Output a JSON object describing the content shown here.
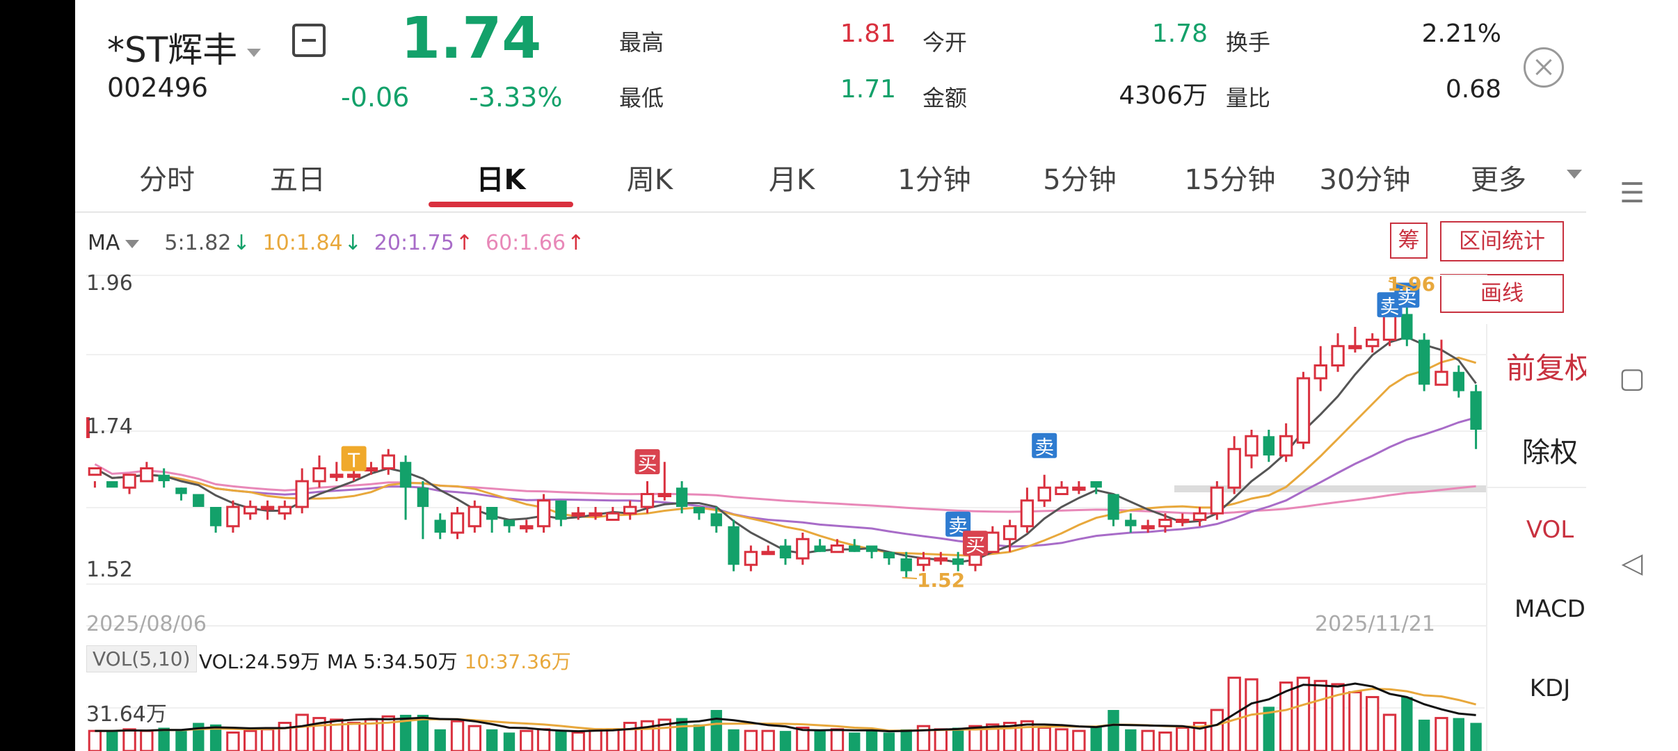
{
  "stock": {
    "name": "*ST辉丰",
    "code": "002496",
    "price": "1.74",
    "change": "-0.06",
    "change_pct": "-3.33%"
  },
  "quote": {
    "high_label": "最高",
    "high": "1.81",
    "open_label": "今开",
    "open": "1.78",
    "turnover_label": "换手",
    "turnover": "2.21%",
    "low_label": "最低",
    "low": "1.71",
    "amount_label": "金额",
    "amount": "4306万",
    "volratio_label": "量比",
    "volratio": "0.68"
  },
  "tabs": [
    "分时",
    "五日",
    "日K",
    "周K",
    "月K",
    "1分钟",
    "5分钟",
    "15分钟",
    "30分钟",
    "更多"
  ],
  "active_tab": "日K",
  "ma": {
    "label": "MA",
    "ma5": "5:1.82",
    "ma10": "10:1.84",
    "ma20": "20:1.75",
    "ma60": "60:1.66",
    "arrow_down": "↓",
    "arrow_up": "↑"
  },
  "side_buttons": {
    "chip": "筹",
    "interval_stats": "区间统计",
    "draw_line": "画线"
  },
  "adjust": {
    "forward": "前复权",
    "ex_right": "除权"
  },
  "indicators": [
    "VOL",
    "MACD",
    "KDJ"
  ],
  "axis": {
    "high": "1.96",
    "mid": "1.74",
    "low": "1.52",
    "start_date": "2025/08/06",
    "end_date": "2025/11/21",
    "vol_max": "31.64万"
  },
  "markers": {
    "max_label": "1.96",
    "min_label": "1.52",
    "buy": "买",
    "sell": "卖",
    "t": "T"
  },
  "volume": {
    "box": "VOL(5,10)",
    "vol": "VOL:24.59万",
    "ma5": "MA 5:34.50万",
    "ma10": "10:37.36万"
  },
  "colors": {
    "up": "#d9303e",
    "down": "#13a16a",
    "ma5": "#555555",
    "ma10": "#e8a83c",
    "ma20": "#a86cc8",
    "ma60": "#e888b8",
    "buy_marker": "#d9434f",
    "sell_marker": "#2e7bd0",
    "t_marker": "#f0a92b"
  },
  "chart_data": {
    "type": "candlestick",
    "candles": [
      [
        1.67,
        1.68,
        1.66,
        1.65
      ],
      [
        1.66,
        1.65,
        1.64,
        1.64
      ],
      [
        1.65,
        1.67,
        1.67,
        1.64
      ],
      [
        1.66,
        1.68,
        1.69,
        1.66
      ],
      [
        1.67,
        1.66,
        1.68,
        1.65
      ],
      [
        1.65,
        1.64,
        1.65,
        1.63
      ],
      [
        1.64,
        1.62,
        1.64,
        1.62
      ],
      [
        1.62,
        1.59,
        1.62,
        1.58
      ],
      [
        1.59,
        1.62,
        1.63,
        1.58
      ],
      [
        1.61,
        1.62,
        1.63,
        1.6
      ],
      [
        1.62,
        1.62,
        1.63,
        1.6
      ],
      [
        1.61,
        1.62,
        1.63,
        1.6
      ],
      [
        1.62,
        1.66,
        1.68,
        1.61
      ],
      [
        1.66,
        1.68,
        1.7,
        1.65
      ],
      [
        1.67,
        1.67,
        1.69,
        1.66
      ],
      [
        1.67,
        1.67,
        1.68,
        1.66
      ],
      [
        1.68,
        1.68,
        1.69,
        1.67
      ],
      [
        1.68,
        1.7,
        1.71,
        1.67
      ],
      [
        1.69,
        1.65,
        1.7,
        1.6
      ],
      [
        1.65,
        1.62,
        1.66,
        1.57
      ],
      [
        1.6,
        1.58,
        1.61,
        1.57
      ],
      [
        1.58,
        1.61,
        1.62,
        1.57
      ],
      [
        1.59,
        1.62,
        1.63,
        1.58
      ],
      [
        1.62,
        1.6,
        1.62,
        1.58
      ],
      [
        1.6,
        1.59,
        1.6,
        1.58
      ],
      [
        1.59,
        1.59,
        1.6,
        1.58
      ],
      [
        1.59,
        1.63,
        1.64,
        1.58
      ],
      [
        1.63,
        1.6,
        1.63,
        1.59
      ],
      [
        1.61,
        1.61,
        1.62,
        1.6
      ],
      [
        1.61,
        1.61,
        1.62,
        1.6
      ],
      [
        1.6,
        1.61,
        1.62,
        1.6
      ],
      [
        1.61,
        1.62,
        1.63,
        1.6
      ],
      [
        1.62,
        1.64,
        1.66,
        1.61
      ],
      [
        1.64,
        1.64,
        1.69,
        1.63
      ],
      [
        1.65,
        1.62,
        1.66,
        1.61
      ],
      [
        1.62,
        1.61,
        1.62,
        1.6
      ],
      [
        1.61,
        1.59,
        1.62,
        1.58
      ],
      [
        1.59,
        1.53,
        1.6,
        1.52
      ],
      [
        1.53,
        1.55,
        1.56,
        1.52
      ],
      [
        1.55,
        1.55,
        1.56,
        1.55
      ],
      [
        1.56,
        1.54,
        1.57,
        1.53
      ],
      [
        1.54,
        1.57,
        1.58,
        1.53
      ],
      [
        1.56,
        1.55,
        1.57,
        1.55
      ],
      [
        1.55,
        1.56,
        1.57,
        1.55
      ],
      [
        1.56,
        1.55,
        1.57,
        1.55
      ],
      [
        1.56,
        1.55,
        1.56,
        1.54
      ],
      [
        1.55,
        1.54,
        1.55,
        1.53
      ],
      [
        1.54,
        1.52,
        1.55,
        1.51
      ],
      [
        1.53,
        1.54,
        1.55,
        1.52
      ],
      [
        1.54,
        1.54,
        1.55,
        1.53
      ],
      [
        1.54,
        1.53,
        1.55,
        1.52
      ],
      [
        1.53,
        1.56,
        1.57,
        1.52
      ],
      [
        1.55,
        1.58,
        1.59,
        1.55
      ],
      [
        1.57,
        1.59,
        1.6,
        1.55
      ],
      [
        1.59,
        1.63,
        1.65,
        1.58
      ],
      [
        1.63,
        1.65,
        1.67,
        1.62
      ],
      [
        1.64,
        1.65,
        1.66,
        1.64
      ],
      [
        1.65,
        1.65,
        1.66,
        1.64
      ],
      [
        1.66,
        1.65,
        1.66,
        1.64
      ],
      [
        1.64,
        1.6,
        1.64,
        1.59
      ],
      [
        1.6,
        1.59,
        1.61,
        1.58
      ],
      [
        1.59,
        1.59,
        1.6,
        1.58
      ],
      [
        1.59,
        1.6,
        1.61,
        1.58
      ],
      [
        1.6,
        1.6,
        1.61,
        1.59
      ],
      [
        1.6,
        1.61,
        1.62,
        1.59
      ],
      [
        1.61,
        1.65,
        1.66,
        1.6
      ],
      [
        1.65,
        1.71,
        1.73,
        1.64
      ],
      [
        1.7,
        1.73,
        1.74,
        1.68
      ],
      [
        1.73,
        1.7,
        1.74,
        1.69
      ],
      [
        1.7,
        1.73,
        1.75,
        1.69
      ],
      [
        1.72,
        1.82,
        1.83,
        1.71
      ],
      [
        1.82,
        1.84,
        1.87,
        1.8
      ],
      [
        1.84,
        1.87,
        1.89,
        1.83
      ],
      [
        1.87,
        1.87,
        1.9,
        1.86
      ],
      [
        1.87,
        1.88,
        1.89,
        1.86
      ],
      [
        1.88,
        1.92,
        1.93,
        1.87
      ],
      [
        1.92,
        1.88,
        1.96,
        1.87
      ],
      [
        1.88,
        1.81,
        1.89,
        1.8
      ],
      [
        1.81,
        1.83,
        1.88,
        1.81
      ],
      [
        1.83,
        1.8,
        1.84,
        1.79
      ],
      [
        1.8,
        1.74,
        1.81,
        1.71
      ]
    ],
    "volumes": [
      9,
      9,
      10,
      9,
      11,
      9,
      14,
      13,
      8,
      9,
      10,
      14,
      19,
      17,
      16,
      14,
      16,
      18,
      19,
      19,
      10,
      15,
      12,
      10,
      8,
      9,
      10,
      9,
      8,
      10,
      10,
      14,
      15,
      16,
      17,
      13,
      22,
      10,
      9,
      9,
      9,
      11,
      9,
      10,
      8,
      9,
      8,
      10,
      12,
      10,
      11,
      12,
      13,
      14,
      15,
      11,
      10,
      9,
      12,
      22,
      10,
      9,
      8,
      11,
      14,
      22,
      42,
      41,
      24,
      39,
      42,
      40,
      38,
      33,
      30,
      19,
      30,
      16,
      17,
      17,
      14
    ],
    "ylim": [
      1.5,
      1.98
    ],
    "x_start": "2025/08/06",
    "x_end": "2025/11/21"
  }
}
